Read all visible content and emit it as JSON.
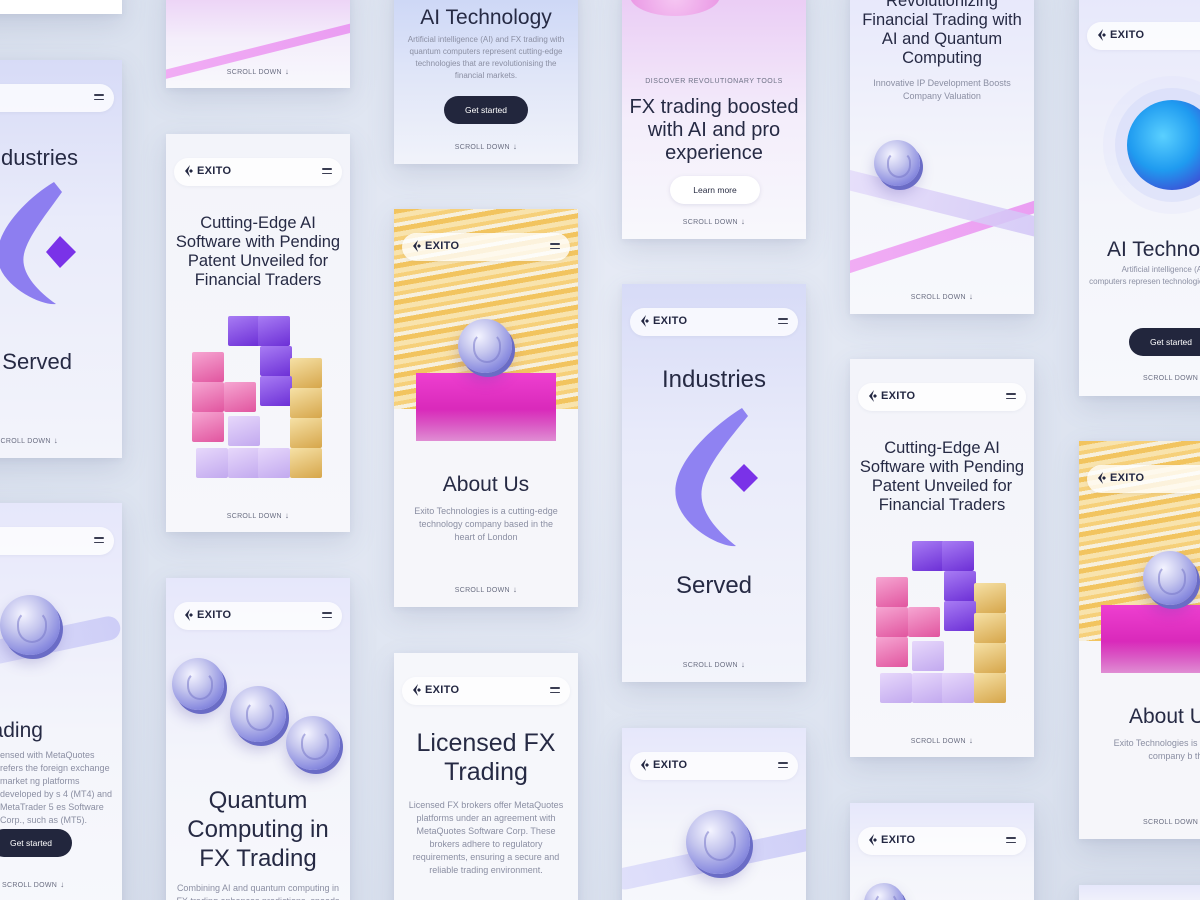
{
  "brand": {
    "logo_text": "EXITO",
    "accent": "#22263d",
    "pink": "#e63fce",
    "violet": "#7b4ef0",
    "gold": "#d8a84f"
  },
  "common": {
    "scroll_down": "SCROLL DOWN",
    "arrow": "↓"
  },
  "screens": {
    "industries_left": {
      "title_top": "dustries",
      "title_bottom": "Served"
    },
    "trading_left": {
      "title": "X Trading",
      "body": "ensed with MetaQuotes refers the foreign exchange market ng platforms developed by s 4 (MT4) and MetaTrader 5 es Software Corp., such as (MT5).",
      "button": "Get started"
    },
    "cutting_edge": {
      "title": "Cutting-Edge AI Software with Pending Patent Unveiled for Financial Traders"
    },
    "quantum": {
      "title": "Quantum Computing in FX Trading",
      "body": "Combining AI and quantum computing in FX trading enhances predictions, speeds"
    },
    "ai_tech": {
      "title": "AI Technology",
      "body": "Artificial intelligence (AI) and FX trading with quantum computers represent cutting-edge technologies that are revolutionising the financial markets.",
      "button": "Get started"
    },
    "about": {
      "title": "About Us",
      "body": "Exito Technologies is a cutting-edge technology company based in the heart of London"
    },
    "licensed": {
      "title": "Licensed FX Trading",
      "body": "Licensed FX brokers offer MetaQuotes platforms under an agreement with MetaQuotes Software Corp. These brokers adhere to regulatory requirements, ensuring a secure and reliable trading environment."
    },
    "fx_boosted": {
      "eyebrow": "DISCOVER REVOLUTIONARY TOOLS",
      "title": "FX trading boosted with AI and pro experience",
      "button": "Learn more"
    },
    "industries_center": {
      "title_top": "Industries",
      "title_bottom": "Served"
    },
    "revolutionizing": {
      "title": "Revolutionizing Financial Trading with AI and Quantum Computing",
      "subtitle": "Innovative IP Development Boosts Company Valuation"
    },
    "cutting_edge_right": {
      "title": "Cutting-Edge AI Software with Pending Patent Unveiled for Financial Traders"
    },
    "ai_tech_right": {
      "title": "AI Technol",
      "body": "Artificial intelligence (AI) and F quantum computers represen technologies that are revolut financial markets",
      "button": "Get started"
    },
    "about_right": {
      "title": "About U",
      "body": "Exito Technologies is a cu technology company b the heart of Lond"
    }
  }
}
